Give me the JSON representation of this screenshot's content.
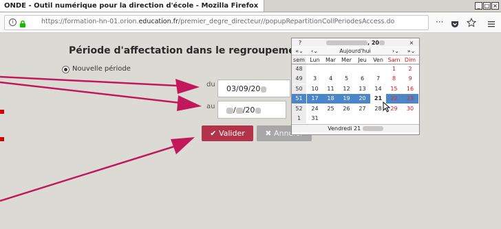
{
  "window": {
    "title": "ONDE - Outil numérique pour la direction d'école - Mozilla Firefox",
    "controls": [
      "_",
      "□",
      "×"
    ]
  },
  "browser": {
    "url_prefix": "https://formation-hn-01.orion.",
    "url_domain": "education.fr",
    "url_suffix": "/premier_degre_directeur//popupRepartitionCollPeriodesAccess.do",
    "info_icon": "info-icon",
    "lock_icon": "lock-icon",
    "menu_dots": "···",
    "pocket_icon": "pocket-icon",
    "bookmark_icon": "star-icon",
    "hamburger_icon": "menu-icon"
  },
  "page": {
    "heading": "Période d'affectation dans le regroupement Re",
    "radio_label": "Nouvelle période",
    "du_label": "du",
    "du_value": "03/09/20",
    "au_label": "au",
    "au_value_sep1": "/",
    "au_value_year": "/20",
    "valider_label": "Valider",
    "annuler_label": "Annuler"
  },
  "calendar": {
    "help": "?",
    "close": "×",
    "title_suffix": ", 20",
    "nav_prev_year": "«",
    "nav_prev_month": "‹",
    "today_label": "Aujourd'hui",
    "nav_next_month": "›",
    "nav_next_year": "»",
    "headers": [
      "sem",
      "Lun",
      "Mar",
      "Mer",
      "Jeu",
      "Ven",
      "Sam",
      "Dim"
    ],
    "weeks": [
      {
        "wk": "48",
        "days": [
          "",
          "",
          "",
          "",
          "",
          "1",
          "2"
        ]
      },
      {
        "wk": "49",
        "days": [
          "3",
          "4",
          "5",
          "6",
          "7",
          "8",
          "9"
        ]
      },
      {
        "wk": "50",
        "days": [
          "10",
          "11",
          "12",
          "13",
          "14",
          "15",
          "16"
        ]
      },
      {
        "wk": "51",
        "days": [
          "17",
          "18",
          "19",
          "20",
          "21",
          "22",
          "23"
        ]
      },
      {
        "wk": "52",
        "days": [
          "24",
          "25",
          "26",
          "27",
          "28",
          "29",
          "30"
        ]
      },
      {
        "wk": "1",
        "days": [
          "31",
          "",
          "",
          "",
          "",
          "",
          ""
        ]
      }
    ],
    "footer": "Vendredi 21"
  },
  "colors": {
    "accent": "#b2344b",
    "arrow": "#c2185b",
    "selection": "#4a86c8"
  }
}
